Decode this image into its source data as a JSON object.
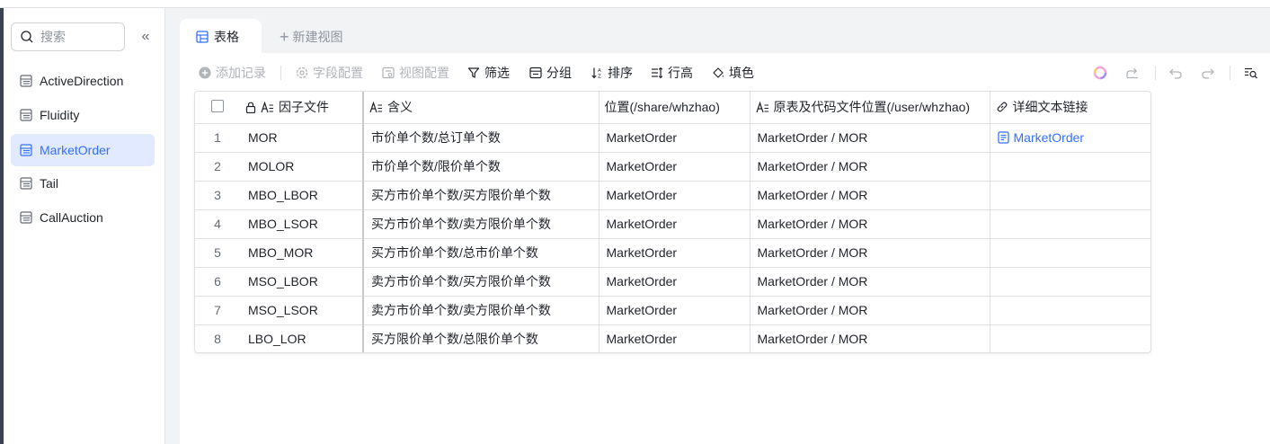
{
  "sidebar": {
    "search_placeholder": "搜索",
    "items": [
      {
        "label": "ActiveDirection"
      },
      {
        "label": "Fluidity"
      },
      {
        "label": "MarketOrder"
      },
      {
        "label": "Tail"
      },
      {
        "label": "CallAuction"
      }
    ],
    "active_item": "MarketOrder"
  },
  "tabs": {
    "active_label": "表格",
    "new_view_label": "新建视图"
  },
  "toolbar": {
    "add_record": "添加记录",
    "field_config": "字段配置",
    "view_config": "视图配置",
    "filter": "筛选",
    "group": "分组",
    "sort": "排序",
    "row_height": "行高",
    "fill_color": "填色"
  },
  "table": {
    "columns": [
      "因子文件",
      "含义",
      "位置(/share/whzhao)",
      "原表及代码文件位置(/user/whzhao)",
      "详细文本链接"
    ],
    "rows": [
      {
        "idx": "1",
        "factor": "MOR",
        "meaning": "市价单个数/总订单个数",
        "location": "MarketOrder",
        "source": "MarketOrder / MOR",
        "link": "MarketOrder"
      },
      {
        "idx": "2",
        "factor": "MOLOR",
        "meaning": "市价单个数/限价单个数",
        "location": "MarketOrder",
        "source": "MarketOrder / MOR",
        "link": ""
      },
      {
        "idx": "3",
        "factor": "MBO_LBOR",
        "meaning": "买方市价单个数/买方限价单个数",
        "location": "MarketOrder",
        "source": "MarketOrder / MOR",
        "link": ""
      },
      {
        "idx": "4",
        "factor": "MBO_LSOR",
        "meaning": "买方市价单个数/卖方限价单个数",
        "location": "MarketOrder",
        "source": "MarketOrder / MOR",
        "link": ""
      },
      {
        "idx": "5",
        "factor": "MBO_MOR",
        "meaning": "买方市价单个数/总市价单个数",
        "location": "MarketOrder",
        "source": "MarketOrder / MOR",
        "link": ""
      },
      {
        "idx": "6",
        "factor": "MSO_LBOR",
        "meaning": "卖方市价单个数/买方限价单个数",
        "location": "MarketOrder",
        "source": "MarketOrder / MOR",
        "link": ""
      },
      {
        "idx": "7",
        "factor": "MSO_LSOR",
        "meaning": "卖方市价单个数/卖方限价单个数",
        "location": "MarketOrder",
        "source": "MarketOrder / MOR",
        "link": ""
      },
      {
        "idx": "8",
        "factor": "LBO_LOR",
        "meaning": "买方限价单个数/总限价单个数",
        "location": "MarketOrder",
        "source": "MarketOrder / MOR",
        "link": ""
      }
    ]
  },
  "colors": {
    "accent": "#3370ff",
    "active_bg": "#e1eaff",
    "border": "#dee0e3"
  }
}
